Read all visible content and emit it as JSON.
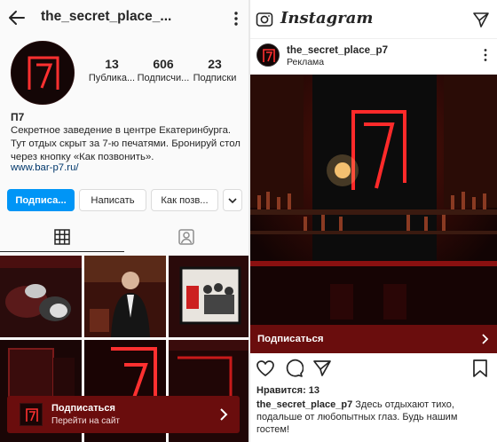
{
  "left": {
    "username": "the_secret_place_...",
    "stats": [
      {
        "value": "13",
        "label": "Публика..."
      },
      {
        "value": "606",
        "label": "Подписчи..."
      },
      {
        "value": "23",
        "label": "Подписки"
      }
    ],
    "name": "П7",
    "bio": "Секретное заведение в центре Екатеринбурга. Тут отдых скрыт за 7-ю печатями. Бронируй стол через кнопку «Как позвонить».",
    "link": "www.bar-p7.ru/",
    "buttons": {
      "subscribe": "Подписа...",
      "message": "Написать",
      "call": "Как позв..."
    },
    "ad": {
      "title": "Подписаться",
      "subtitle": "Перейти на сайт"
    }
  },
  "right": {
    "app_title": "Instagram",
    "username": "the_secret_place_p7",
    "subtitle": "Реклама",
    "cta": "Подписаться",
    "likes": "Нравится: 13",
    "caption_user": "the_secret_place_p7",
    "caption_text": " Здесь отдыхают тихо, подальше от любопытных глаз. Будь нашим гостем!"
  },
  "colors": {
    "accent": "#0095f6",
    "ad_red": "#6a0d0d",
    "neon": "#ff2a2a",
    "link": "#00376b"
  }
}
